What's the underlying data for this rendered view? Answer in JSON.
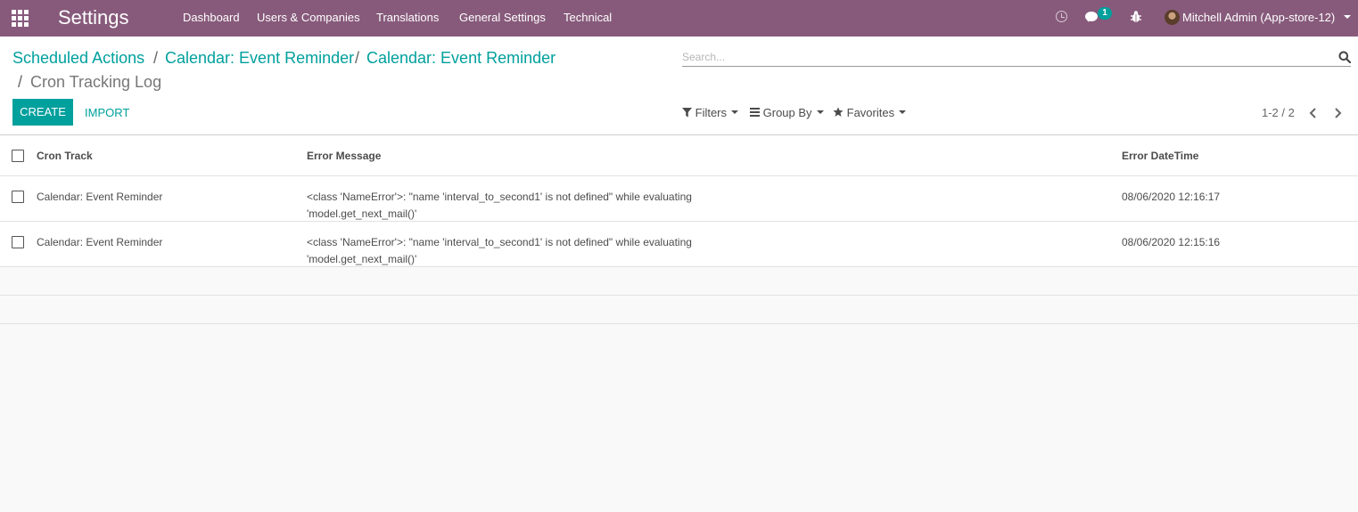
{
  "navbar": {
    "brand": "Settings",
    "menu": [
      "Dashboard",
      "Users & Companies",
      "Translations",
      "General Settings",
      "Technical"
    ],
    "chat_count": "1",
    "user_name": "Mitchell Admin (App-store-12)"
  },
  "breadcrumbs": {
    "items": [
      "Scheduled Actions",
      "Calendar: Event Reminder",
      "Calendar: Event Reminder"
    ],
    "current": "Cron Tracking Log",
    "separator": "/"
  },
  "search": {
    "placeholder": "Search..."
  },
  "buttons": {
    "create": "CREATE",
    "import": "IMPORT"
  },
  "search_options": {
    "filters": "Filters",
    "group_by": "Group By",
    "favorites": "Favorites"
  },
  "pager": {
    "value": "1-2 / 2"
  },
  "table": {
    "columns": [
      "Cron Track",
      "Error Message",
      "Error DateTime"
    ],
    "rows": [
      {
        "cron_track": "Calendar: Event Reminder",
        "error_message": "<class 'NameError'>: \"name 'interval_to_second1' is not defined\" while evaluating 'model.get_next_mail()'",
        "error_datetime": "08/06/2020 12:16:17"
      },
      {
        "cron_track": "Calendar: Event Reminder",
        "error_message": "<class 'NameError'>: \"name 'interval_to_second1' is not defined\" while evaluating 'model.get_next_mail()'",
        "error_datetime": "08/06/2020 12:15:16"
      }
    ]
  },
  "colors": {
    "brand": "#875a7b",
    "accent": "#00a09d"
  }
}
